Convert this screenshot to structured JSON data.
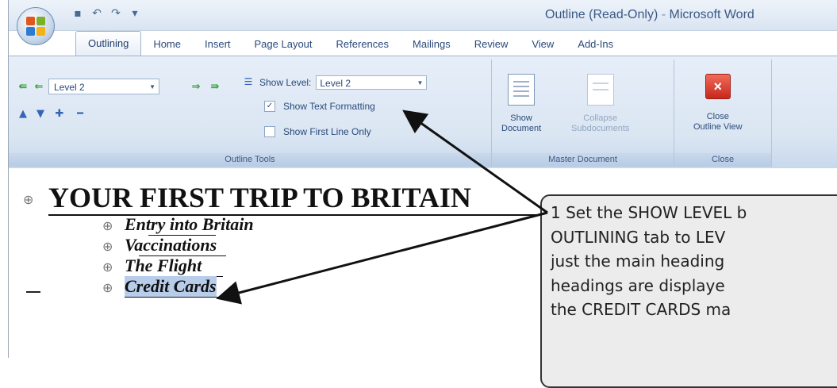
{
  "titlebar": {
    "title_doc": "Outline (Read-Only)",
    "title_sep": "-",
    "title_app": "Microsoft Word",
    "qat_icons": [
      "save-icon",
      "undo-icon",
      "redo-icon",
      "customize-icon"
    ],
    "qat_glyphs": {
      "save": "▪",
      "undo": "↶",
      "redo": "↷",
      "customize": "▾"
    }
  },
  "tabs": [
    {
      "label": "Outlining",
      "active": true
    },
    {
      "label": "Home"
    },
    {
      "label": "Insert"
    },
    {
      "label": "Page Layout"
    },
    {
      "label": "References"
    },
    {
      "label": "Mailings"
    },
    {
      "label": "Review"
    },
    {
      "label": "View"
    },
    {
      "label": "Add-Ins"
    }
  ],
  "ribbon": {
    "outline_tools": {
      "label": "Outline Tools",
      "level_value": "Level 2",
      "show_level_label": "Show Level:",
      "show_level_value": "Level 2",
      "show_text_formatting": "Show Text Formatting",
      "show_text_formatting_checked": true,
      "show_first_line_only": "Show First Line Only",
      "show_first_line_only_checked": false,
      "glyphs": {
        "promote_heading": "⇚",
        "promote": "⇐",
        "demote": "⇒",
        "demote_body": "⇛",
        "move_up": "▲",
        "move_down": "▼",
        "expand": "✚",
        "collapse": "━",
        "dropdown": "▼",
        "check": "✓"
      }
    },
    "master_document": {
      "label": "Master Document",
      "show_document": [
        "Show",
        "Document"
      ],
      "collapse_subdocuments": [
        "Collapse",
        "Subdocuments"
      ]
    },
    "close": {
      "label": "Close",
      "close_outline_view": [
        "Close",
        "Outline View"
      ],
      "close_glyph": "×"
    }
  },
  "document": {
    "heading": "YOUR FIRST TRIP TO BRITAIN",
    "outline_symbol": "⊕",
    "subheadings": [
      "Entry into Britain",
      "Vaccinations",
      "The Flight",
      "Credit Cards"
    ]
  },
  "callout": {
    "lines": [
      "1  Set the SHOW LEVEL b",
      "   OUTLINING tab to LEV",
      "   just the main heading",
      "   headings are displaye",
      "   the CREDIT CARDS ma"
    ]
  },
  "colors": {
    "ribbon_bg": "#dbe6f3",
    "selection": "#b8cdea",
    "callout_bg": "#ececec",
    "close_red": "#c8271b"
  }
}
